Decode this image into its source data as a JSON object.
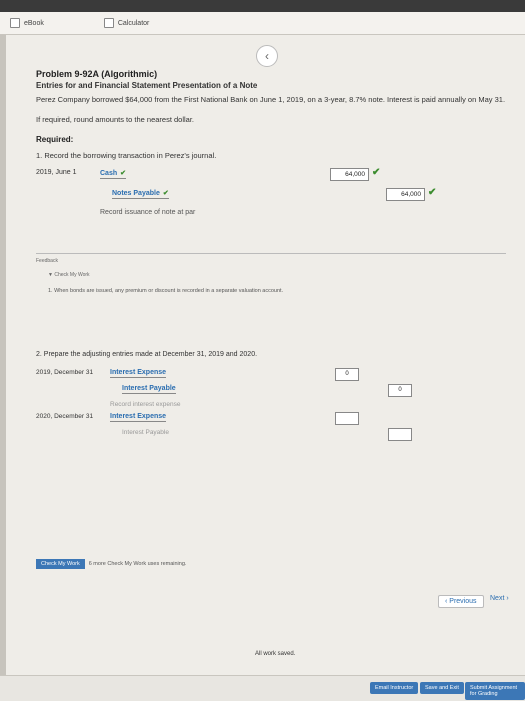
{
  "toolbar": {
    "ebook_label": "eBook",
    "calculator_label": "Calculator"
  },
  "problem": {
    "title": "Problem 9-92A (Algorithmic)",
    "subtitle": "Entries for and Financial Statement Presentation of a Note",
    "statement": "Perez Company borrowed $64,000 from the First National Bank on June 1, 2019, on a 3-year, 8.7% note. Interest is paid annually on May 31.",
    "rounding": "If required, round amounts to the nearest dollar.",
    "required_label": "Required:"
  },
  "q1": {
    "prompt": "1. Record the borrowing transaction in Perez's journal.",
    "date": "2019, June 1",
    "debit_account": "Cash",
    "debit_amount": "64,000",
    "credit_account": "Notes Payable",
    "credit_amount": "64,000",
    "description": "Record issuance of note at par"
  },
  "feedback": {
    "label": "Feedback",
    "check_label": "▼ Check My Work",
    "line": "1. When bonds are issued, any premium or discount is recorded in a separate valuation account."
  },
  "q2": {
    "prompt": "2. Prepare the adjusting entries made at December 31, 2019 and 2020.",
    "date_2019": "2019, December 31",
    "debit_account_2019": "Interest Expense",
    "debit_amount_2019": "0",
    "credit_account_2019": "Interest Payable",
    "credit_amount_2019": "0",
    "description_2019": "Record interest expense",
    "date_2020": "2020, December 31",
    "debit_account_2020": "Interest Expense",
    "credit_account_2020": "Interest Payable"
  },
  "bottom": {
    "check_button": "Check My Work",
    "check_remaining": "6 more Check My Work uses remaining.",
    "previous": "Previous",
    "next": "Next",
    "saved": "All work saved."
  },
  "footer": {
    "email": "Email Instructor",
    "save_exit": "Save and Exit",
    "submit": "Submit Assignment for Grading"
  },
  "colors": {
    "accent": "#3c77b6",
    "check": "#3b8c2e",
    "link": "#2a6db0"
  }
}
